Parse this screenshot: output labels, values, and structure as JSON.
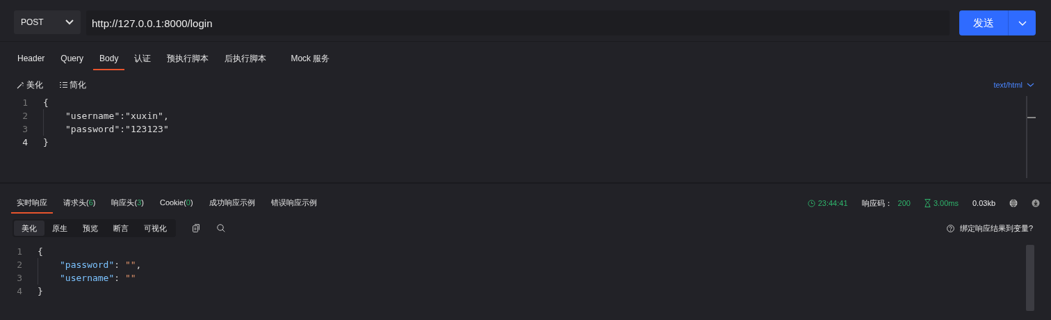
{
  "request": {
    "method": "POST",
    "url": "http://127.0.0.1:8000/login",
    "send_label": "发送"
  },
  "request_tabs": [
    {
      "label": "Header",
      "selected": false
    },
    {
      "label": "Query",
      "selected": false
    },
    {
      "label": "Body",
      "selected": true
    },
    {
      "label": "认证",
      "selected": false
    },
    {
      "label": "预执行脚本",
      "selected": false
    },
    {
      "label": "后执行脚本",
      "selected": false
    },
    {
      "label": "Mock 服务",
      "selected": false
    }
  ],
  "body_toolbar": {
    "beautify": "美化",
    "simplify": "简化",
    "content_type": "text/html"
  },
  "body_editor": {
    "lines": [
      {
        "number": "1",
        "active": false,
        "text": "{",
        "children": [
          {
            "number": "2",
            "active": false,
            "text": "\"username\":\"xuxin\","
          },
          {
            "number": "3",
            "active": false,
            "text": "\"password\":\"123123\""
          }
        ]
      },
      {
        "number": "4",
        "active": true,
        "text": "}"
      }
    ]
  },
  "response_tabs": [
    {
      "before": "实时响应",
      "selected": true
    },
    {
      "before": "请求头(",
      "count": "6",
      "after": ")",
      "selected": false
    },
    {
      "before": "响应头(",
      "count": "3",
      "after": ")",
      "selected": false
    },
    {
      "before": "Cookie(",
      "count": "0",
      "after": ")",
      "selected": false
    },
    {
      "before": "成功响应示例",
      "selected": false
    },
    {
      "before": "错误响应示例",
      "selected": false
    }
  ],
  "response_status": {
    "time": "23:44:41",
    "code_label": "响应码：",
    "code": "200",
    "duration": "3.00ms",
    "size": "0.03kb"
  },
  "view_modes": [
    {
      "label": "美化",
      "selected": true
    },
    {
      "label": "原生",
      "selected": false
    },
    {
      "label": "预览",
      "selected": false
    },
    {
      "label": "断言",
      "selected": false
    },
    {
      "label": "可视化",
      "selected": false
    }
  ],
  "bind_hint": "绑定响应结果到变量?",
  "response_editor": {
    "lines": [
      {
        "number": "1",
        "active": false,
        "segments": [
          {
            "kind": "punct",
            "text": "{"
          }
        ],
        "children": [
          {
            "number": "2",
            "active": false,
            "segments": [
              {
                "kind": "key",
                "text": "\"password\""
              },
              {
                "kind": "punct",
                "text": ": "
              },
              {
                "kind": "string",
                "text": "\"\""
              },
              {
                "kind": "punct",
                "text": ","
              }
            ]
          },
          {
            "number": "3",
            "active": false,
            "segments": [
              {
                "kind": "key",
                "text": "\"username\""
              },
              {
                "kind": "punct",
                "text": ": "
              },
              {
                "kind": "string",
                "text": "\"\""
              }
            ]
          }
        ]
      },
      {
        "number": "4",
        "active": false,
        "segments": [
          {
            "kind": "punct",
            "text": "}"
          }
        ]
      }
    ]
  }
}
